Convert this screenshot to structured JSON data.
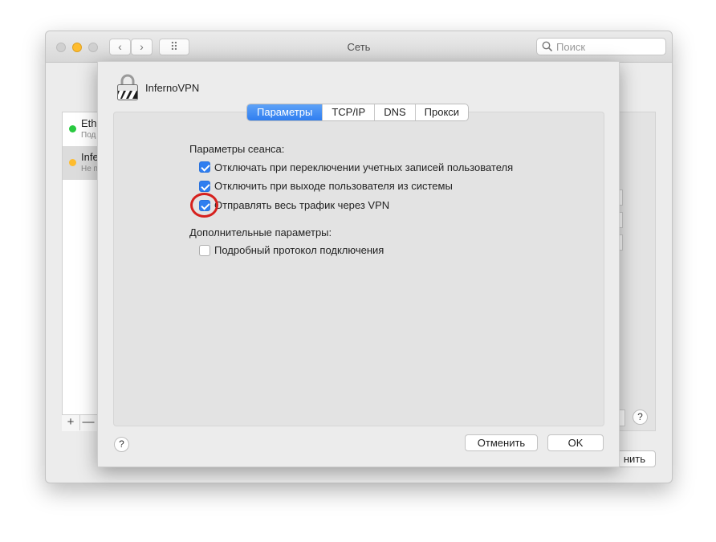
{
  "window": {
    "title": "Сеть",
    "search_placeholder": "Поиск",
    "nav_back": "‹",
    "nav_forward": "›",
    "grid_icon": "⠿",
    "colors": {
      "close": "#fd5f57",
      "minimize": "#febc2e",
      "zoom": "#d0d0d0"
    }
  },
  "sidebar": {
    "items": [
      {
        "name": "Ethe",
        "status": "Под",
        "dot_color": "#29c940"
      },
      {
        "name": "Infe",
        "status": "Не п",
        "dot_color": "#febc2e"
      }
    ],
    "add": "+",
    "remove": "—"
  },
  "background": {
    "apply_label": "нить",
    "help": "?"
  },
  "sheet": {
    "vpn_name": "InfernoVPN",
    "tabs": [
      {
        "label": "Параметры",
        "active": true
      },
      {
        "label": "TCP/IP",
        "active": false
      },
      {
        "label": "DNS",
        "active": false
      },
      {
        "label": "Прокси",
        "active": false
      }
    ],
    "session_label": "Параметры сеанса:",
    "options": [
      {
        "label": "Отключать при переключении учетных записей пользователя",
        "checked": true
      },
      {
        "label": "Отключить при выходе пользователя из системы",
        "checked": true
      },
      {
        "label": "Отправлять весь трафик через VPN",
        "checked": true,
        "highlighted": true
      }
    ],
    "advanced_label": "Дополнительные параметры:",
    "advanced_options": [
      {
        "label": "Подробный протокол подключения",
        "checked": false
      }
    ],
    "help": "?",
    "cancel_label": "Отменить",
    "ok_label": "OK",
    "accent_color": "#2f7ef0",
    "highlight_color": "#d6211e"
  }
}
